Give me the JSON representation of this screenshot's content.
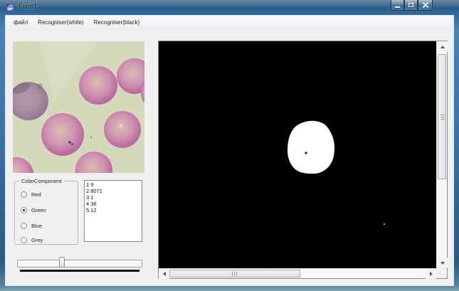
{
  "window": {
    "title": "Form1",
    "controls": [
      {
        "name": "minimize"
      },
      {
        "name": "maximize"
      },
      {
        "name": "close"
      }
    ]
  },
  "menu": {
    "items": [
      "файл",
      "Recogniser(white)",
      "Recogniser(black)"
    ]
  },
  "color_component": {
    "title": "ColorComponent",
    "options": [
      {
        "label": "Red",
        "selected": false
      },
      {
        "label": "Green",
        "selected": true
      },
      {
        "label": "Blue",
        "selected": false
      },
      {
        "label": "Grey",
        "selected": false
      }
    ]
  },
  "results_list": {
    "items": [
      "1 9",
      "2 8071",
      "3 1",
      "4 36",
      "5 12"
    ]
  },
  "trackbar": {
    "thumb_percent": 36
  },
  "right_panel": {
    "v_scrollbar": {
      "thumb_top_pct": 1,
      "thumb_height_pct": 61
    },
    "h_scrollbar": {
      "thumb_left_pct": 0,
      "thumb_width_pct": 51
    }
  },
  "colors": {
    "titlebar_blue": "#3b74a5",
    "client_bg": "#f0f0f0",
    "mask_bg": "#000000",
    "mask_blob": "#ffffff",
    "cell_pink": "#c177a4",
    "cell_rim": "#af679a",
    "slide_bg": "#d6d8bc"
  }
}
